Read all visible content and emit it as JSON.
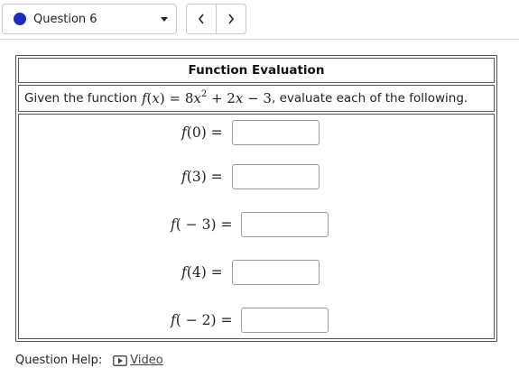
{
  "question_selector": {
    "label": "Question 6",
    "dot_color": "#1c2fb4"
  },
  "nav": {
    "prev_icon": "chevron-left-icon",
    "next_icon": "chevron-right-icon"
  },
  "table": {
    "title": "Function Evaluation",
    "prompt_before": "Given the function",
    "prompt_after": ", evaluate each of the following.",
    "function": {
      "name": "f",
      "var": "x",
      "coef": "8",
      "power": "2",
      "rest_a": " + 2",
      "rest_b": " − 3"
    },
    "rows": [
      {
        "arg": "0",
        "value": ""
      },
      {
        "arg": "3",
        "value": ""
      },
      {
        "arg": " − 3",
        "value": ""
      },
      {
        "arg": "4",
        "value": ""
      },
      {
        "arg": " − 2",
        "value": ""
      }
    ]
  },
  "help": {
    "label": "Question Help:",
    "video_label": "Video"
  }
}
